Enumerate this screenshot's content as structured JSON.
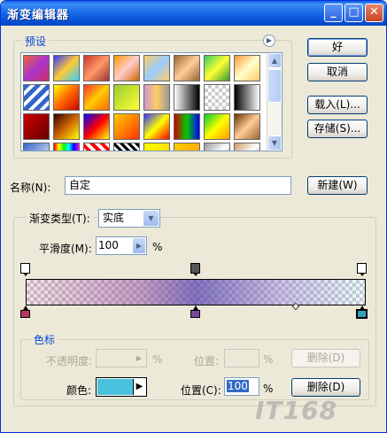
{
  "window": {
    "title": "渐变编辑器"
  },
  "presets": {
    "legend": "预设"
  },
  "buttons": {
    "ok": "好",
    "cancel": "取消",
    "load": "载入(L)...",
    "save": "存储(S)...",
    "new": "新建(W)",
    "delete_opacity": "删除(D)",
    "delete_color": "删除(D)"
  },
  "name": {
    "label": "名称(N):",
    "value": "自定"
  },
  "gradient_type": {
    "label": "渐变类型(T):",
    "value": "实底"
  },
  "smoothness": {
    "label": "平滑度(M):",
    "value": "100",
    "unit": "%"
  },
  "stops": {
    "legend": "色标",
    "opacity_label": "不透明度:",
    "opacity_value": "",
    "opacity_unit": "%",
    "opacity_location_label": "位置:",
    "opacity_location_unit": "%",
    "color_label": "颜色:",
    "color_value": "#49c3dd",
    "color_location_label": "位置(C):",
    "color_location_value": "100",
    "color_location_unit": "%"
  },
  "colors": {
    "stop_left": "#b5375f",
    "stop_mid": "#7a4a9a",
    "stop_right": "#2fa4bd"
  },
  "watermark": "IT168"
}
